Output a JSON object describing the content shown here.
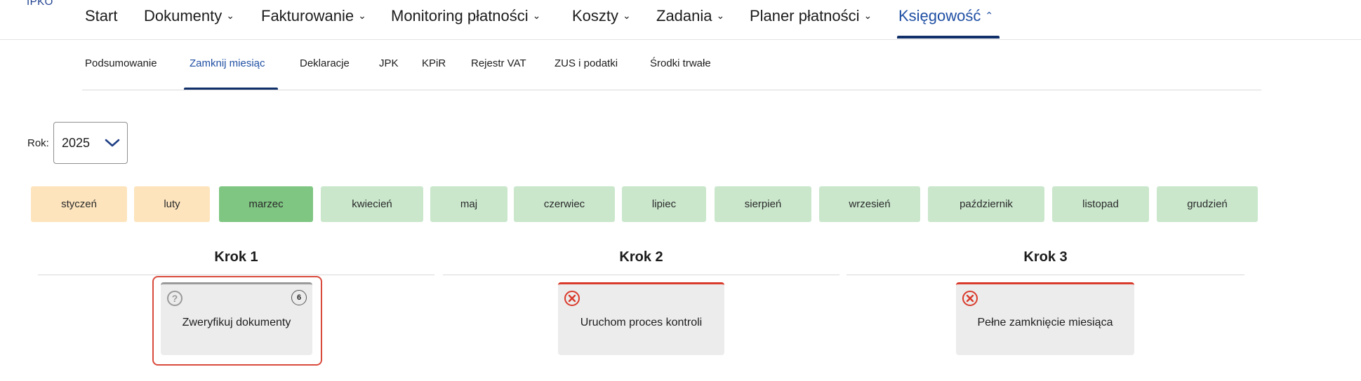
{
  "app": {
    "logo": "IPKO"
  },
  "topnav": {
    "items": [
      {
        "label": "Start",
        "chevron": ""
      },
      {
        "label": "Dokumenty",
        "chevron": "⌄"
      },
      {
        "label": "Fakturowanie",
        "chevron": "⌄"
      },
      {
        "label": "Monitoring płatności",
        "chevron": "⌄"
      },
      {
        "label": "Koszty",
        "chevron": "⌄"
      },
      {
        "label": "Zadania",
        "chevron": "⌄"
      },
      {
        "label": "Planer płatności",
        "chevron": "⌄"
      },
      {
        "label": "Księgowość",
        "chevron": "⌃"
      }
    ],
    "active_index": 7
  },
  "subnav": {
    "items": [
      {
        "label": "Podsumowanie"
      },
      {
        "label": "Zamknij miesiąc"
      },
      {
        "label": "Deklaracje"
      },
      {
        "label": "JPK"
      },
      {
        "label": "KPiR"
      },
      {
        "label": "Rejestr VAT"
      },
      {
        "label": "ZUS i podatki"
      },
      {
        "label": "Środki trwałe"
      }
    ],
    "active_index": 1
  },
  "year": {
    "label": "Rok:",
    "value": "2025",
    "icon": "chevron-down-icon"
  },
  "months": [
    {
      "label": "styczeń",
      "state": "past"
    },
    {
      "label": "luty",
      "state": "past"
    },
    {
      "label": "marzec",
      "state": "current"
    },
    {
      "label": "kwiecień",
      "state": "future"
    },
    {
      "label": "maj",
      "state": "future"
    },
    {
      "label": "czerwiec",
      "state": "future"
    },
    {
      "label": "lipiec",
      "state": "future"
    },
    {
      "label": "sierpień",
      "state": "future"
    },
    {
      "label": "wrzesień",
      "state": "future"
    },
    {
      "label": "październik",
      "state": "future"
    },
    {
      "label": "listopad",
      "state": "future"
    },
    {
      "label": "grudzień",
      "state": "future"
    }
  ],
  "colors": {
    "past": "#fde4bd",
    "current": "#80c683",
    "future": "#cae7cc",
    "accent": "#11306a",
    "error": "#d93a2b",
    "highlight": "#d94a3c"
  },
  "steps": [
    {
      "title": "Krok 1",
      "card": {
        "label": "Zweryfikuj dokumenty",
        "status_icon": "question-icon",
        "badge": "6",
        "state": "pending"
      }
    },
    {
      "title": "Krok 2",
      "card": {
        "label": "Uruchom proces kontroli",
        "status_icon": "error-icon",
        "badge": "",
        "state": "error"
      }
    },
    {
      "title": "Krok 3",
      "card": {
        "label": "Pełne zamknięcie miesiąca",
        "status_icon": "error-icon",
        "badge": "",
        "state": "error"
      }
    }
  ]
}
